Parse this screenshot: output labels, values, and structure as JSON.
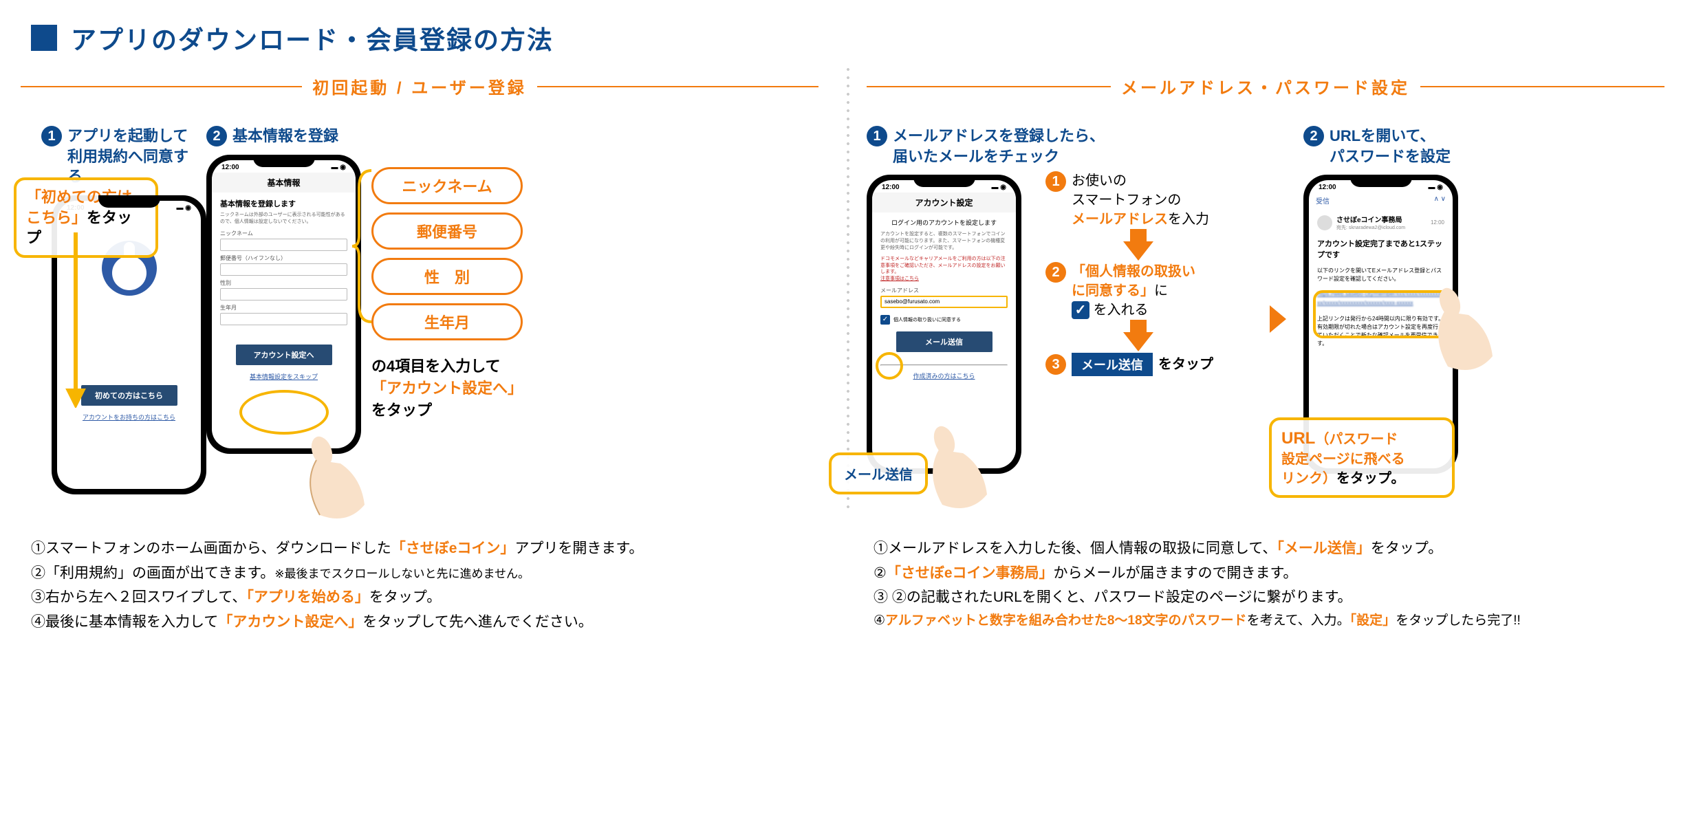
{
  "title": "アプリのダウンロード・会員登録の方法",
  "sections": {
    "left": {
      "label": "初回起動 / ユーザー登録"
    },
    "right": {
      "label": "メールアドレス・パスワード設定"
    }
  },
  "left_steps": {
    "s1": {
      "num": "1",
      "text": "アプリを起動して\n利用規約へ同意する"
    },
    "s2": {
      "num": "2",
      "text": "基本情報を登録"
    }
  },
  "right_steps": {
    "s1": {
      "num": "1",
      "text": "メールアドレスを登録したら、\n届いたメールをチェック"
    },
    "s2": {
      "num": "2",
      "text": "URLを開いて、\nパスワードを設定"
    }
  },
  "phone1": {
    "time": "12:00",
    "btn": "初めての方はこちら",
    "link": "アカウントをお持ちの方はこちら"
  },
  "phone2": {
    "time": "12:00",
    "heading": "基本情報",
    "sub": "基本情報を登録します",
    "note": "ニックネームは外部のユーザーに表示される可能性があるので、個人情報は設定しないでください。",
    "f1": "ニックネーム",
    "f2": "郵便番号（ハイフンなし）",
    "f3": "性別",
    "f4": "生年月",
    "btn": "アカウント設定へ",
    "skip": "基本情報設定をスキップ"
  },
  "phone3": {
    "time": "12:00",
    "heading": "アカウント設定",
    "sub": "ログイン用のアカウントを設定します",
    "note1": "アカウントを設定すると、複数のスマートフォンでコインの利用が可能になります。また、スマートフォンの機種変更や紛失時にログインが可能です。",
    "warn": "ドコモメールなどキャリアメールをご利用の方は以下の注意事項をご確認いただき、メールアドレスの設定をお願いします。",
    "warnlink": "注意事項はこちら",
    "emaillabel": "メールアドレス",
    "email": "sasebo@furusato.com",
    "consent": "個人情報の取り扱いに同意する",
    "btn": "メール送信",
    "link2": "作成済みの方はこちら"
  },
  "phone4": {
    "time": "12:00",
    "back": "受信",
    "sender": "させぼeコイン事務局",
    "to": "宛先: sknaradewa2@icloud.com",
    "t": "12:00",
    "subject": "アカウント設定完了まであと1ステップです",
    "body1": "以下のリンクを開いてEメールアドレス登録とパスワード設定を確認してください。",
    "body2": "上記リンクは発行から24時間以内に限り有効です。有効期限が切れた場合はアカウント設定を再度行っていただくことで新たな確認メールを再受信できます。"
  },
  "callouts": {
    "c1a": "「初めての方は",
    "c1b": "こちら」",
    "c1c": "をタップ",
    "pills": [
      "ニックネーム",
      "郵便番号",
      "性　別",
      "生年月"
    ],
    "c2a": "の4項目を入力して",
    "c2b": "「アカウント設定へ」",
    "c2c": "をタップ",
    "sub1a": "お使いの",
    "sub1b": "スマートフォンの",
    "sub1c": "メールアドレス",
    "sub1d": "を入力",
    "sub2a": "「個人情報の取扱い",
    "sub2b": "に同意する」",
    "sub2c": "に",
    "sub2d": "を入れる",
    "sub3a": "メール送信",
    "sub3b": "をタップ",
    "c4a": "URL",
    "c4b": "（パスワード",
    "c4c": "設定ページに飛べる",
    "c4d": "リンク）",
    "c4e": "をタップ。"
  },
  "desc_left": {
    "l1a": "①スマートフォンのホーム画面から、ダウンロードした",
    "l1b": "「させぼeコイン」",
    "l1c": "アプリを開きます。",
    "l2a": "②「利用規約」の画面が出てきます。",
    "l2b": "※最後までスクロールしないと先に進めません。",
    "l3a": "③右から左へ２回スワイプして、",
    "l3b": "「アプリを始める」",
    "l3c": "をタップ。",
    "l4a": "④最後に基本情報を入力して",
    "l4b": "「アカウント設定へ」",
    "l4c": "をタップして先へ進んでください。"
  },
  "desc_right": {
    "l1a": "①メールアドレスを入力した後、個人情報の取扱に同意して、",
    "l1b": "「メール送信」",
    "l1c": "をタップ。",
    "l2a": "②",
    "l2b": "「させぼeコイン事務局」",
    "l2c": "からメールが届きますので開きます。",
    "l3": "③ ②の記載されたURLを開くと、パスワード設定のページに繋がります。",
    "l4a": "④",
    "l4b": "アルファベットと数字を組み合わせた8～18文字のパスワード",
    "l4c": "を考えて、入力。",
    "l4d": "「設定」",
    "l4e": "をタップしたら完了!!"
  }
}
